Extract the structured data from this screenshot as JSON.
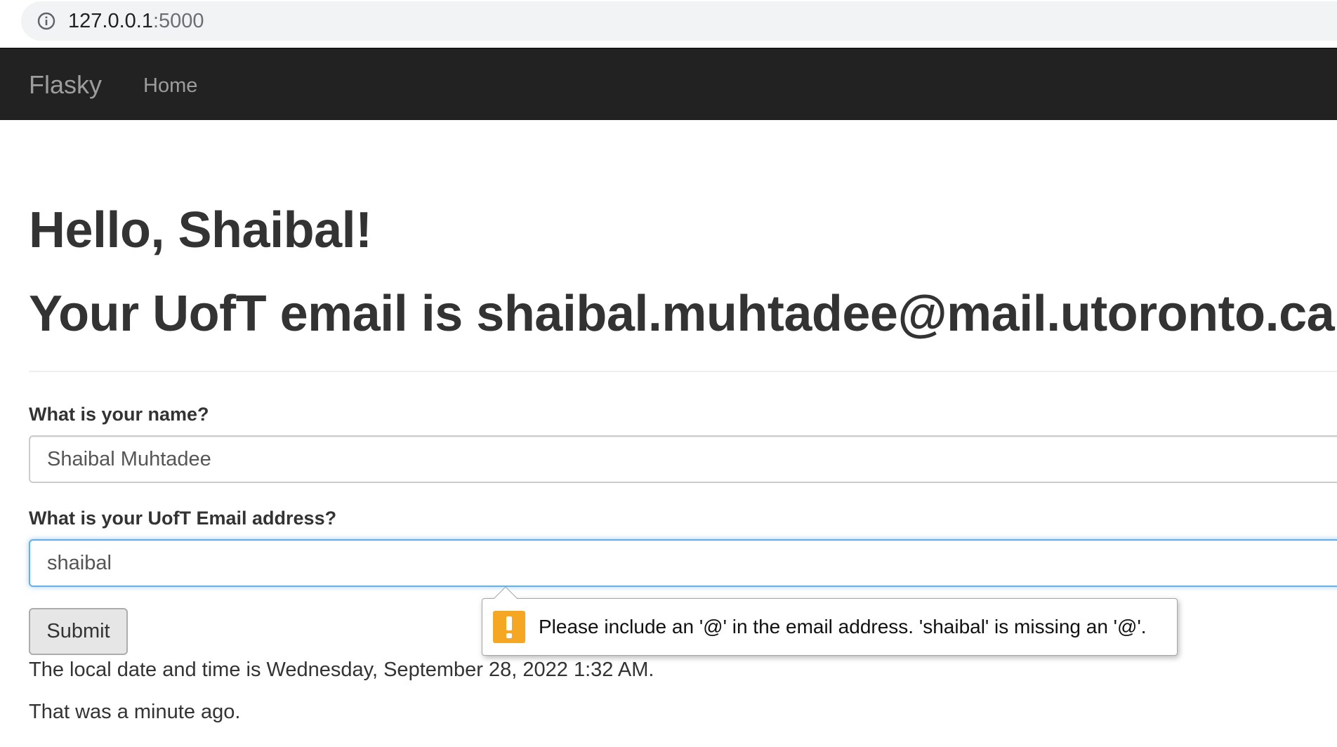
{
  "browser": {
    "url_host": "127.0.0.1",
    "url_port": ":5000",
    "info_icon": "info-icon"
  },
  "navbar": {
    "brand": "Flasky",
    "links": [
      {
        "label": "Home"
      }
    ]
  },
  "main": {
    "greeting": "Hello, Shaibal!",
    "email_heading": "Your UofT email is shaibal.muhtadee@mail.utoronto.ca",
    "form": {
      "name_label": "What is your name?",
      "name_value": "Shaibal Muhtadee",
      "email_label": "What is your UofT Email address?",
      "email_value": "shaibal",
      "submit_label": "Submit"
    },
    "local_time_text": "The local date and time is Wednesday, September 28, 2022 1:32 AM.",
    "relative_time_text": "That was a minute ago."
  },
  "validation_tooltip": {
    "icon": "warning-icon",
    "message": "Please include an '@' in the email address. 'shaibal' is missing an '@'."
  },
  "colors": {
    "navbar_bg": "#222222",
    "navbar_text": "#9d9d9d",
    "focus_border": "#66afe9",
    "warning": "#f5a623"
  }
}
